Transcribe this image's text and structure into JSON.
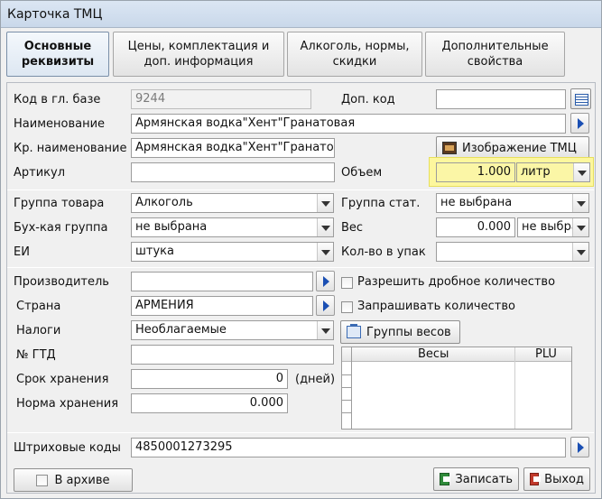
{
  "window": {
    "title": "Карточка ТМЦ"
  },
  "tabs": [
    {
      "label": "Основные\nреквизиты",
      "active": true
    },
    {
      "label": "Цены, комплектация и\nдоп.  информация",
      "active": false
    },
    {
      "label": "Алкоголь, нормы,\nскидки",
      "active": false
    },
    {
      "label": "Дополнительные\nсвойства",
      "active": false
    }
  ],
  "main": {
    "code_label": "Код в гл. базе",
    "code_value": "9244",
    "extra_code_label": "Доп. код",
    "extra_code_value": "",
    "name_label": "Наименование",
    "name_value": "Армянская водка\"Хент\"Гранатовая",
    "short_name_label": "Кр. наименование",
    "short_name_value": "Армянская водка\"Хент\"Гранатовая",
    "image_button": "Изображение ТМЦ",
    "article_label": "Артикул",
    "article_value": "",
    "volume_label": "Объем",
    "volume_value": "1.000",
    "volume_unit": "литр"
  },
  "groups": {
    "product_group_label": "Группа товара",
    "product_group_value": "Алкоголь",
    "stat_group_label": "Группа стат.",
    "stat_group_value": "не выбрана",
    "acc_group_label": "Бух-кая группа",
    "acc_group_value": "не выбрана",
    "weight_label": "Вес",
    "weight_value": "0.000",
    "weight_unit": "не выбра",
    "unit_label": "ЕИ",
    "unit_value": "штука",
    "pack_qty_label": "Кол-во в упак",
    "pack_qty_value": ""
  },
  "details": {
    "manufacturer_label": "Производитель",
    "manufacturer_value": "",
    "allow_fraction_label": "Разрешить дробное количество",
    "country_label": "Страна",
    "country_value": "АРМЕНИЯ",
    "ask_qty_label": "Запрашивать количество",
    "taxes_label": "Налоги",
    "taxes_value": "Необлагаемые",
    "weight_groups_button": "Группы весов",
    "gtd_label": "№ ГТД",
    "gtd_value": "",
    "shelf_life_label": "Срок хранения",
    "shelf_life_value": "0",
    "shelf_life_unit": "(дней)",
    "storage_norm_label": "Норма хранения",
    "storage_norm_value": "0.000",
    "scales_header_weights": "Весы",
    "scales_header_plu": "PLU",
    "barcodes_label": "Штриховые коды",
    "barcodes_value": "4850001273295"
  },
  "footer": {
    "archive_label": "В архиве",
    "save_button": "Записать",
    "exit_button": "Выход"
  }
}
